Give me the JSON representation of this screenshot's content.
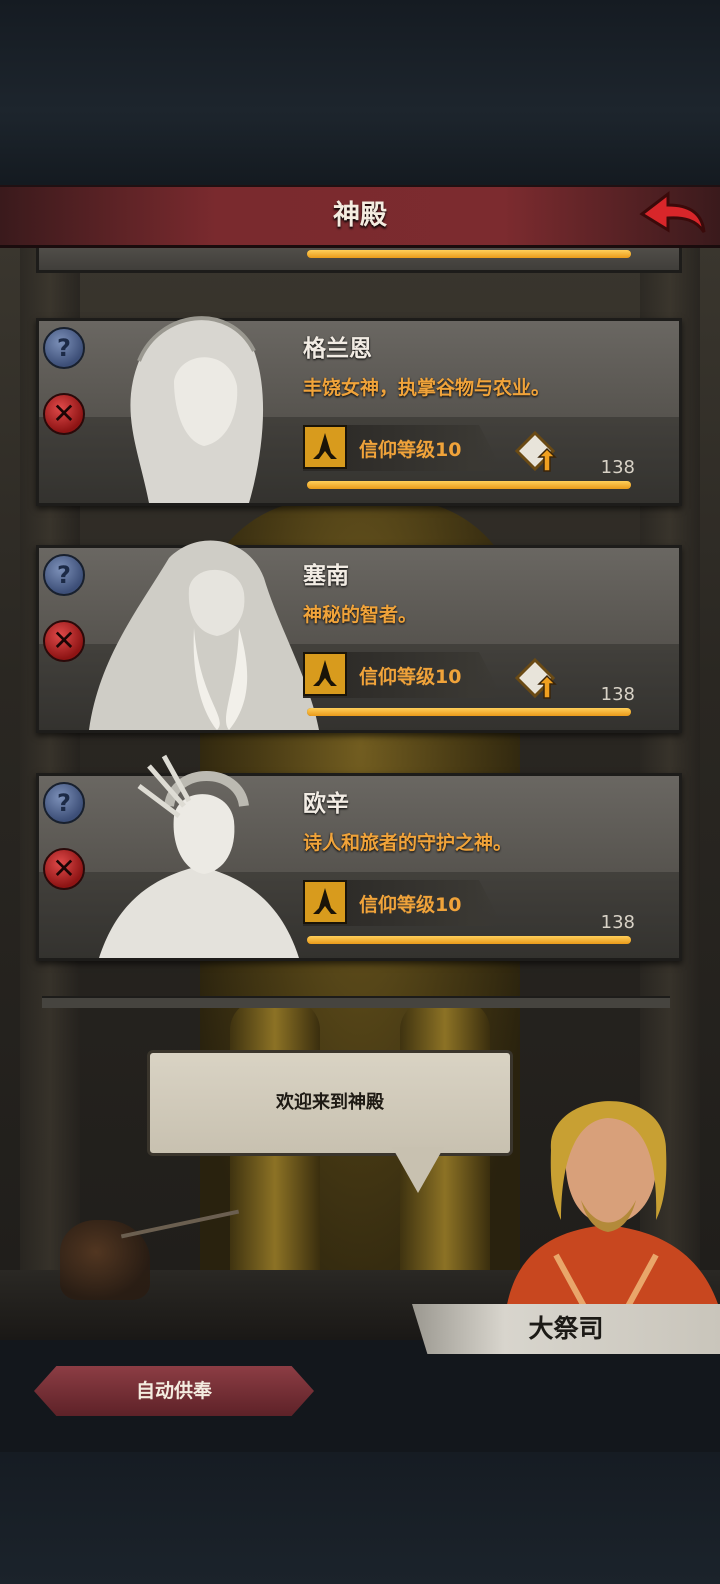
{
  "header": {
    "title": "神殿"
  },
  "gods": [
    {
      "name": "格兰恩",
      "description": "丰饶女神，执掌谷物与农业。",
      "faith_label": "信仰等级10",
      "count": "138",
      "progress": 1.0,
      "upgrade_available": true
    },
    {
      "name": "塞南",
      "description": "神秘的智者。",
      "faith_label": "信仰等级10",
      "count": "138",
      "progress": 1.0,
      "upgrade_available": true
    },
    {
      "name": "欧辛",
      "description": "诗人和旅者的守护之神。",
      "faith_label": "信仰等级10",
      "count": "138",
      "progress": 1.0,
      "upgrade_available": false
    }
  ],
  "dialog": {
    "message": "欢迎来到神殿",
    "speaker": "大祭司"
  },
  "footer": {
    "auto_offer_label": "自动供奉"
  },
  "colors": {
    "accent_orange": "#f0a33a",
    "header_red": "#7a2a2e",
    "gold": "#d89b1d"
  }
}
